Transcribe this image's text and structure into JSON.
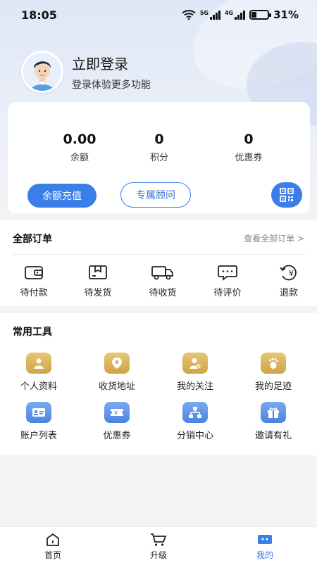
{
  "status_bar": {
    "time": "18:05",
    "net1": "5G",
    "net2": "4G",
    "battery": "31%",
    "battery_level": 0.31
  },
  "profile": {
    "title": "立即登录",
    "subtitle": "登录体验更多功能"
  },
  "stats": [
    {
      "value": "0.00",
      "label": "余额"
    },
    {
      "value": "0",
      "label": "积分"
    },
    {
      "value": "0",
      "label": "优惠券"
    }
  ],
  "buttons": {
    "recharge": "余额充值",
    "advisor": "专属顾问"
  },
  "orders": {
    "title": "全部订单",
    "view_all": "查看全部订单 >",
    "items": [
      {
        "label": "待付款",
        "icon": "wallet-icon"
      },
      {
        "label": "待发货",
        "icon": "package-icon"
      },
      {
        "label": "待收货",
        "icon": "truck-icon"
      },
      {
        "label": "待评价",
        "icon": "comment-icon"
      },
      {
        "label": "退款",
        "icon": "refund-icon"
      }
    ]
  },
  "tools": {
    "title": "常用工具",
    "items": [
      {
        "label": "个人资料",
        "icon": "person-icon",
        "color": "gold"
      },
      {
        "label": "收货地址",
        "icon": "location-icon",
        "color": "gold"
      },
      {
        "label": "我的关注",
        "icon": "follow-icon",
        "color": "gold"
      },
      {
        "label": "我的足迹",
        "icon": "footprint-icon",
        "color": "gold"
      },
      {
        "label": "账户列表",
        "icon": "id-card-icon",
        "color": "blue"
      },
      {
        "label": "优惠券",
        "icon": "coupon-icon",
        "color": "blue"
      },
      {
        "label": "分销中心",
        "icon": "network-icon",
        "color": "blue"
      },
      {
        "label": "邀请有礼",
        "icon": "gift-icon",
        "color": "blue"
      }
    ]
  },
  "tabbar": {
    "items": [
      {
        "label": "首页",
        "icon": "home-icon"
      },
      {
        "label": "升级",
        "icon": "cart-icon"
      },
      {
        "label": "我的",
        "icon": "profile-tab-icon"
      }
    ],
    "active_index": 2
  },
  "colors": {
    "accent": "#3a7ee8",
    "gold": "#d9b257"
  }
}
